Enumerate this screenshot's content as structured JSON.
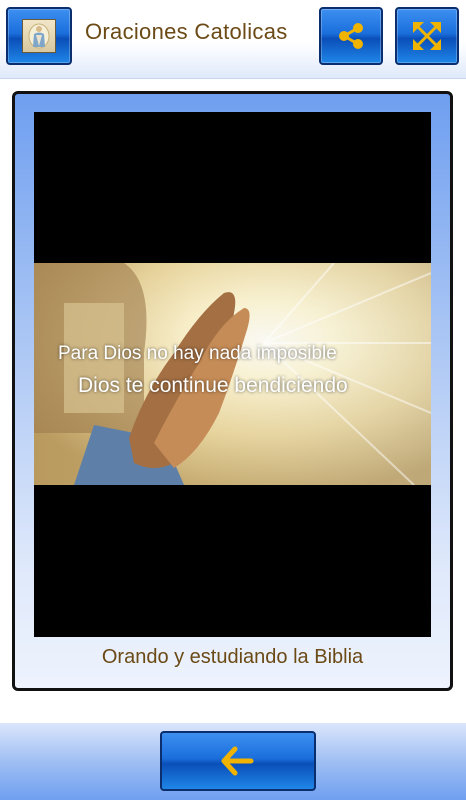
{
  "header": {
    "title": "Oraciones Catolicas",
    "app_icon": "virgin-mary-icon",
    "share_icon": "share-icon",
    "fullscreen_icon": "fullscreen-icon"
  },
  "content": {
    "video_text_line1": "Para Dios no hay nada imposible",
    "video_text_line2": "Dios te continue bendiciendo",
    "caption": "Orando y estudiando la Biblia"
  },
  "footer": {
    "back_icon": "arrow-left-icon"
  },
  "colors": {
    "title_text": "#6b4a16",
    "button_blue": "#1b6fdc",
    "icon_gold": "#f0b400"
  }
}
